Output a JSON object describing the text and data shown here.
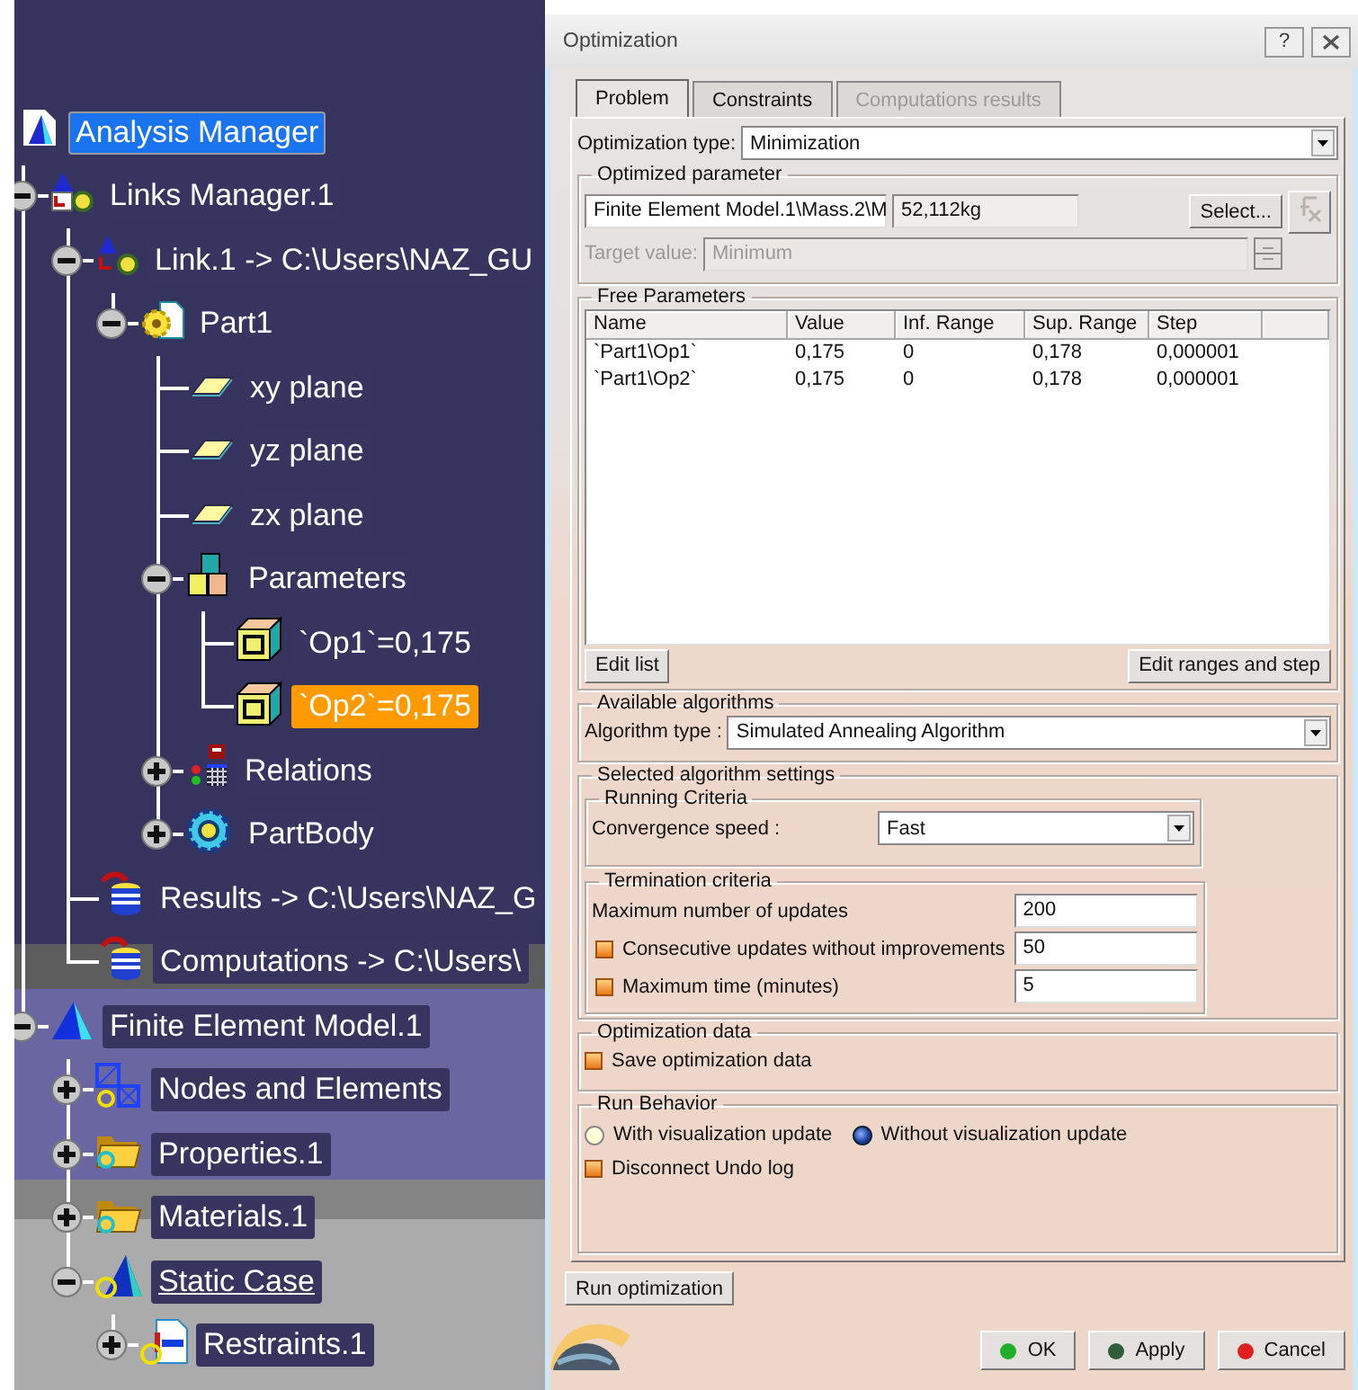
{
  "tree": {
    "items": [
      {
        "label": "Analysis Manager",
        "kind": "analysis",
        "selected": true,
        "highlighted": false,
        "current": false,
        "children": [
          {
            "label": "Links Manager.1",
            "kind": "links",
            "expanded": true,
            "selected": false,
            "highlighted": false,
            "current": false,
            "children": [
              {
                "label": "Link.1 -> C:\\Users\\NAZ_GU",
                "kind": "link",
                "expanded": true,
                "selected": false,
                "highlighted": false,
                "current": false,
                "children": [
                  {
                    "label": "Part1",
                    "kind": "part",
                    "expanded": true,
                    "selected": false,
                    "highlighted": false,
                    "current": false,
                    "children": [
                      {
                        "label": "xy plane",
                        "kind": "plane",
                        "selected": false,
                        "highlighted": false,
                        "current": false
                      },
                      {
                        "label": "yz plane",
                        "kind": "plane",
                        "selected": false,
                        "highlighted": false,
                        "current": false
                      },
                      {
                        "label": "zx plane",
                        "kind": "plane",
                        "selected": false,
                        "highlighted": false,
                        "current": false
                      },
                      {
                        "label": "Parameters",
                        "kind": "parameters",
                        "expanded": true,
                        "selected": false,
                        "highlighted": false,
                        "current": false,
                        "children": [
                          {
                            "label": "`Op1`=0,175",
                            "kind": "parameter",
                            "selected": false,
                            "highlighted": false,
                            "current": false
                          },
                          {
                            "label": "`Op2`=0,175",
                            "kind": "parameter",
                            "selected": false,
                            "highlighted": true,
                            "current": false
                          }
                        ]
                      },
                      {
                        "label": "Relations",
                        "kind": "relations",
                        "expanded": false,
                        "selected": false,
                        "highlighted": false,
                        "current": false
                      },
                      {
                        "label": "PartBody",
                        "kind": "body",
                        "expanded": false,
                        "selected": false,
                        "highlighted": false,
                        "current": false
                      }
                    ]
                  }
                ]
              },
              {
                "label": "Results -> C:\\Users\\NAZ_G",
                "kind": "results",
                "selected": false,
                "highlighted": false,
                "current": false
              },
              {
                "label": "Computations -> C:\\Users\\",
                "kind": "results",
                "selected": false,
                "highlighted": false,
                "current": false
              }
            ]
          },
          {
            "label": "Finite Element Model.1",
            "kind": "fem",
            "expanded": true,
            "selected": false,
            "highlighted": false,
            "current": false,
            "children": [
              {
                "label": "Nodes and Elements",
                "kind": "nodes",
                "expanded": false,
                "selected": false,
                "highlighted": false,
                "current": false
              },
              {
                "label": "Properties.1",
                "kind": "folder",
                "expanded": false,
                "selected": false,
                "highlighted": false,
                "current": false
              },
              {
                "label": "Materials.1",
                "kind": "folder",
                "expanded": false,
                "selected": false,
                "highlighted": false,
                "current": false
              },
              {
                "label": "Static Case",
                "kind": "case",
                "expanded": true,
                "selected": false,
                "highlighted": false,
                "current": true,
                "children": [
                  {
                    "label": "Restraints.1",
                    "kind": "restraint",
                    "expanded": false,
                    "selected": false,
                    "highlighted": false,
                    "current": false
                  }
                ]
              }
            ]
          }
        ]
      }
    ]
  },
  "dialog": {
    "title": "Optimization",
    "help": "?",
    "tabs": [
      {
        "label": "Problem",
        "selected": true,
        "disabled": false
      },
      {
        "label": "Constraints",
        "selected": false,
        "disabled": false
      },
      {
        "label": "Computations results",
        "selected": false,
        "disabled": true
      }
    ],
    "optimization_type": {
      "label": "Optimization type:",
      "value": "Minimization"
    },
    "optimized_parameter": {
      "legend": "Optimized parameter",
      "parameter": "Finite Element Model.1\\Mass.2\\M",
      "value": "52,112kg",
      "select_button": "Select...",
      "target": {
        "label": "Target value:",
        "value": "Minimum",
        "disabled": true
      }
    },
    "free_parameters": {
      "legend": "Free Parameters",
      "table": {
        "columns": [
          "Name",
          "Value",
          "Inf. Range",
          "Sup. Range",
          "Step"
        ],
        "rows": [
          [
            "`Part1\\Op1`",
            "0,175",
            "0",
            "0,178",
            "0,000001"
          ],
          [
            "`Part1\\Op2`",
            "0,175",
            "0",
            "0,178",
            "0,000001"
          ]
        ]
      },
      "buttons": [
        "Edit list",
        "Edit ranges and step"
      ]
    },
    "algorithms": {
      "legend": "Available algorithms",
      "label": "Algorithm type :",
      "value": "Simulated Annealing Algorithm"
    },
    "settings": {
      "legend": "Selected algorithm settings",
      "running": {
        "legend": "Running Criteria",
        "label": "Convergence speed :",
        "value": "Fast"
      },
      "termination": {
        "legend": "Termination criteria",
        "rows": [
          {
            "label": "Maximum number of updates",
            "value": "200",
            "kind": "plain"
          },
          {
            "label": "Consecutive updates without improvements",
            "value": "50",
            "kind": "checkbox",
            "checked": false
          },
          {
            "label": "Maximum time (minutes)",
            "value": "5",
            "kind": "checkbox",
            "checked": false
          }
        ]
      }
    },
    "optimization_data": {
      "legend": "Optimization data",
      "options": [
        {
          "label": "Save optimization data",
          "checked": false
        }
      ]
    },
    "run_behavior": {
      "legend": "Run Behavior",
      "modes": [
        {
          "label": "With visualization update",
          "selected": false
        },
        {
          "label": "Without visualization update",
          "selected": true
        }
      ],
      "options": [
        {
          "label": "Disconnect Undo log",
          "checked": false
        }
      ]
    },
    "run_button": "Run optimization",
    "buttons": [
      {
        "label": "OK",
        "color": "#1fae2a"
      },
      {
        "label": "Apply",
        "color": "#2f5f3a"
      },
      {
        "label": "Cancel",
        "color": "#e0201c"
      }
    ]
  }
}
